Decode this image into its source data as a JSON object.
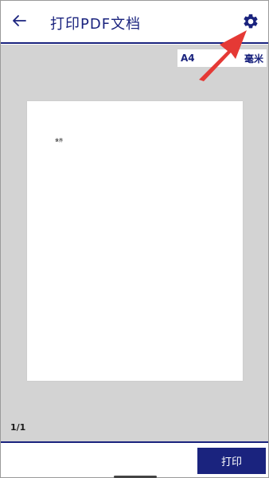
{
  "header": {
    "title": "打印PDF文档",
    "back_icon": "arrow-left-icon",
    "settings_icon": "gear-icon"
  },
  "preview": {
    "paper_size_label": "A4",
    "unit_label": "毫米",
    "page_text": "世界",
    "page_counter": "1/1"
  },
  "footer": {
    "print_label": "打印"
  },
  "colors": {
    "accent": "#1a237e",
    "preview_bg": "#d3d3d3",
    "annotation_arrow": "#e53935"
  }
}
